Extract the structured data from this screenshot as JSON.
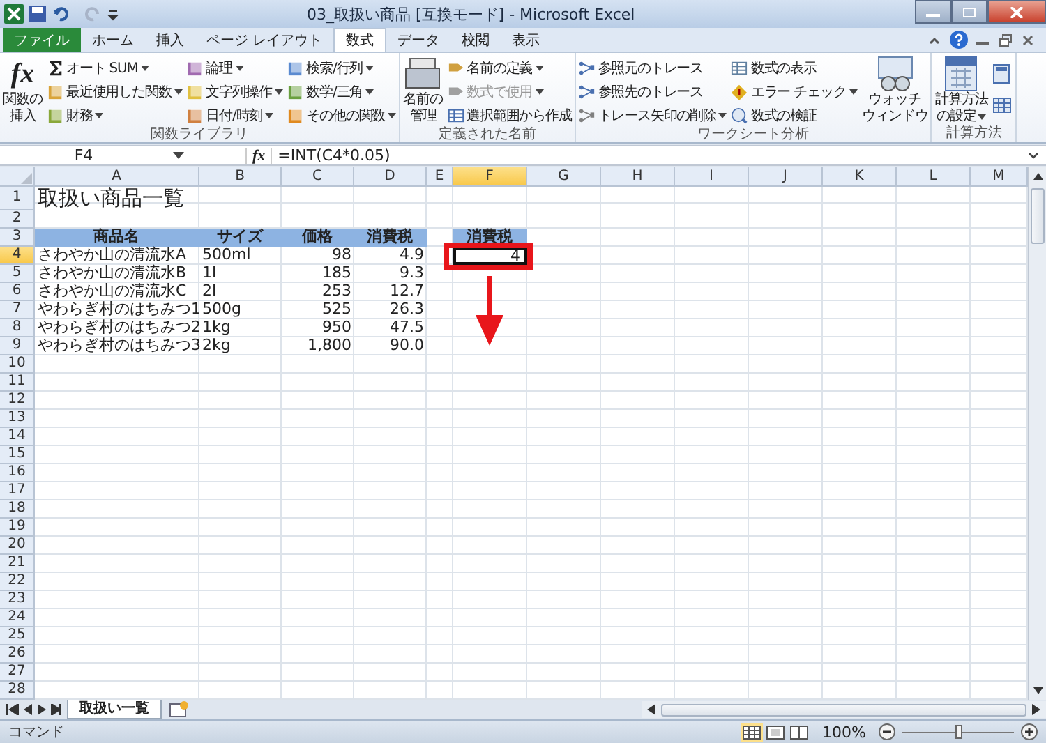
{
  "window": {
    "title": "03_取扱い商品 [互換モード] - Microsoft Excel"
  },
  "tabs": [
    {
      "label": "ファイル",
      "kind": "file",
      "selected": false
    },
    {
      "label": "ホーム",
      "kind": "tab",
      "selected": false
    },
    {
      "label": "挿入",
      "kind": "tab",
      "selected": false
    },
    {
      "label": "ページ レイアウト",
      "kind": "tab",
      "selected": false
    },
    {
      "label": "数式",
      "kind": "tab",
      "selected": true
    },
    {
      "label": "データ",
      "kind": "tab",
      "selected": false
    },
    {
      "label": "校閲",
      "kind": "tab",
      "selected": false
    },
    {
      "label": "表示",
      "kind": "tab",
      "selected": false
    }
  ],
  "ribbon": [
    {
      "label": "関数ライブラリ",
      "parts": [
        {
          "kind": "large",
          "symbol": "fx",
          "lines": [
            "関数の",
            "挿入"
          ],
          "dropdown": false
        },
        {
          "kind": "column",
          "items": [
            {
              "label": "オート SUM",
              "dropdown": true,
              "disabled": false
            },
            {
              "label": "最近使用した関数",
              "dropdown": true,
              "disabled": false
            },
            {
              "label": "財務",
              "dropdown": true,
              "disabled": false
            }
          ]
        },
        {
          "kind": "column",
          "items": [
            {
              "label": "論理",
              "dropdown": true,
              "disabled": false
            },
            {
              "label": "文字列操作",
              "dropdown": true,
              "disabled": false
            },
            {
              "label": "日付/時刻",
              "dropdown": true,
              "disabled": false
            }
          ]
        },
        {
          "kind": "column",
          "items": [
            {
              "label": "検索/行列",
              "dropdown": true,
              "disabled": false
            },
            {
              "label": "数学/三角",
              "dropdown": true,
              "disabled": false
            },
            {
              "label": "その他の関数",
              "dropdown": true,
              "disabled": false
            }
          ]
        }
      ]
    },
    {
      "label": "定義された名前",
      "parts": [
        {
          "kind": "large",
          "lines": [
            "名前の",
            "管理"
          ],
          "dropdown": false
        },
        {
          "kind": "column",
          "items": [
            {
              "label": "名前の定義",
              "dropdown": true,
              "disabled": false
            },
            {
              "label": "数式で使用",
              "dropdown": true,
              "disabled": true
            },
            {
              "label": "選択範囲から作成",
              "dropdown": false,
              "disabled": false
            }
          ]
        }
      ]
    },
    {
      "label": "ワークシート分析",
      "parts": [
        {
          "kind": "column",
          "items": [
            {
              "label": "参照元のトレース",
              "dropdown": false,
              "disabled": false
            },
            {
              "label": "参照先のトレース",
              "dropdown": false,
              "disabled": false
            },
            {
              "label": "トレース矢印の削除",
              "dropdown": true,
              "disabled": false
            }
          ]
        },
        {
          "kind": "column",
          "items": [
            {
              "label": "数式の表示",
              "dropdown": false,
              "disabled": false
            },
            {
              "label": "エラー チェック",
              "dropdown": true,
              "disabled": false
            },
            {
              "label": "数式の検証",
              "dropdown": false,
              "disabled": false
            }
          ]
        },
        {
          "kind": "large",
          "lines": [
            "ウォッチ",
            "ウィンドウ"
          ],
          "dropdown": false
        }
      ]
    },
    {
      "label": "計算方法",
      "parts": [
        {
          "kind": "large",
          "lines": [
            "計算方法",
            "の設定"
          ],
          "dropdown": true
        },
        {
          "kind": "icons"
        }
      ]
    }
  ],
  "formula_bar": {
    "name_box": "F4",
    "fx": "fx",
    "formula": "=INT(C4*0.05)"
  },
  "columns": [
    {
      "label": "A",
      "selected": false
    },
    {
      "label": "B",
      "selected": false
    },
    {
      "label": "C",
      "selected": false
    },
    {
      "label": "D",
      "selected": false
    },
    {
      "label": "E",
      "selected": false
    },
    {
      "label": "F",
      "selected": true
    },
    {
      "label": "G",
      "selected": false
    },
    {
      "label": "H",
      "selected": false
    },
    {
      "label": "I",
      "selected": false
    },
    {
      "label": "J",
      "selected": false
    },
    {
      "label": "K",
      "selected": false
    },
    {
      "label": "L",
      "selected": false
    },
    {
      "label": "M",
      "selected": false
    }
  ],
  "rows": [
    {
      "number": "1",
      "selected": false,
      "cells": [
        {
          "kind": "title",
          "text": "取扱い商品一覧"
        }
      ]
    },
    {
      "number": "2",
      "selected": false
    },
    {
      "number": "3",
      "selected": false,
      "cells": [
        {
          "kind": "header",
          "text": "商品名"
        },
        {
          "kind": "header",
          "text": "サイズ"
        },
        {
          "kind": "header",
          "text": "価格"
        },
        {
          "kind": "header",
          "text": "消費税"
        },
        {
          "kind": "result_header",
          "text": "消費税"
        }
      ]
    },
    {
      "number": "4",
      "selected": true,
      "cells": [
        {
          "kind": "product",
          "text": "さわやか山の清流水A"
        },
        {
          "kind": "size",
          "text": "500ml"
        },
        {
          "kind": "price",
          "text": "98"
        },
        {
          "kind": "tax",
          "text": "4.9"
        },
        {
          "kind": "result",
          "text": "4",
          "selected": true
        }
      ]
    },
    {
      "number": "5",
      "selected": false,
      "cells": [
        {
          "kind": "product",
          "text": "さわやか山の清流水B"
        },
        {
          "kind": "size",
          "text": "1l"
        },
        {
          "kind": "price",
          "text": "185"
        },
        {
          "kind": "tax",
          "text": "9.3"
        }
      ]
    },
    {
      "number": "6",
      "selected": false,
      "cells": [
        {
          "kind": "product",
          "text": "さわやか山の清流水C"
        },
        {
          "kind": "size",
          "text": "2l"
        },
        {
          "kind": "price",
          "text": "253"
        },
        {
          "kind": "tax",
          "text": "12.7"
        }
      ]
    },
    {
      "number": "7",
      "selected": false,
      "cells": [
        {
          "kind": "product",
          "text": "やわらぎ村のはちみつ1"
        },
        {
          "kind": "size",
          "text": "500g"
        },
        {
          "kind": "price",
          "text": "525"
        },
        {
          "kind": "tax",
          "text": "26.3"
        }
      ]
    },
    {
      "number": "8",
      "selected": false,
      "cells": [
        {
          "kind": "product",
          "text": "やわらぎ村のはちみつ2"
        },
        {
          "kind": "size",
          "text": "1kg"
        },
        {
          "kind": "price",
          "text": "950"
        },
        {
          "kind": "tax",
          "text": "47.5"
        }
      ]
    },
    {
      "number": "9",
      "selected": false,
      "cells": [
        {
          "kind": "product",
          "text": "やわらぎ村のはちみつ3"
        },
        {
          "kind": "size",
          "text": "2kg"
        },
        {
          "kind": "price",
          "text": "1,800"
        },
        {
          "kind": "tax",
          "text": "90.0"
        }
      ]
    },
    {
      "number": "10",
      "selected": false
    },
    {
      "number": "11",
      "selected": false
    },
    {
      "number": "12",
      "selected": false
    },
    {
      "number": "13",
      "selected": false
    },
    {
      "number": "14",
      "selected": false
    },
    {
      "number": "15",
      "selected": false
    },
    {
      "number": "16",
      "selected": false
    },
    {
      "number": "17",
      "selected": false
    },
    {
      "number": "18",
      "selected": false
    },
    {
      "number": "19",
      "selected": false
    },
    {
      "number": "20",
      "selected": false
    },
    {
      "number": "21",
      "selected": false
    },
    {
      "number": "22",
      "selected": false
    },
    {
      "number": "23",
      "selected": false
    },
    {
      "number": "24",
      "selected": false
    },
    {
      "number": "25",
      "selected": false
    },
    {
      "number": "26",
      "selected": false
    },
    {
      "number": "27",
      "selected": false
    },
    {
      "number": "28",
      "selected": false
    }
  ],
  "sheet_tabs": [
    {
      "label": "取扱い一覧",
      "selected": true
    }
  ],
  "status_bar": {
    "mode": "コマンド",
    "zoom": "100%",
    "zoom_slider": {
      "level": 0.5
    }
  }
}
